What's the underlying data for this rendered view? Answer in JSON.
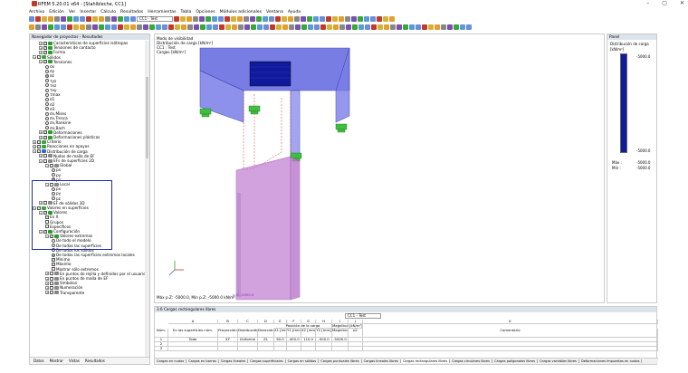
{
  "window": {
    "title": "RFEM 5.20.01 x64 - [Stahlbleche, CC1]",
    "controls": [
      "–",
      "▢",
      "✕"
    ]
  },
  "menu": [
    "Archivo",
    "Edición",
    "Ver",
    "Insertar",
    "Cálculo",
    "Resultados",
    "Herramientas",
    "Tabla",
    "Opciones",
    "Módulos adicionales",
    "Ventana",
    "Ayuda"
  ],
  "toolbar": {
    "case_combo": "CC1 - Test"
  },
  "navigator": {
    "title": "Navegador de proyectos - Resultados",
    "items": [
      {
        "label": "Características de superficies isótropas",
        "level": 1,
        "ex": "+",
        "cb": true,
        "color": "#2b9b2b"
      },
      {
        "label": "Tensiones de contacto",
        "level": 1,
        "ex": "+",
        "cb": true,
        "color": "#2b9b2b"
      },
      {
        "label": "Forma",
        "level": 1,
        "ex": "+",
        "cb": true,
        "color": "#2b9b2b"
      },
      {
        "label": "Sólidos",
        "level": 0,
        "ex": "−",
        "cb": true,
        "color": "#3aa63a"
      },
      {
        "label": "Tensiones",
        "level": 1,
        "ex": "−",
        "cb": true,
        "color": "#2b9b2b"
      },
      {
        "label": "σx",
        "level": 2,
        "radio": false
      },
      {
        "label": "σy",
        "level": 2,
        "radio": false
      },
      {
        "label": "σz",
        "level": 2,
        "radio": true
      },
      {
        "label": "τyz",
        "level": 2,
        "radio": false
      },
      {
        "label": "τxz",
        "level": 2,
        "radio": false
      },
      {
        "label": "τxy",
        "level": 2,
        "radio": false
      },
      {
        "label": "τmax",
        "level": 2,
        "radio": false
      },
      {
        "label": "σ1",
        "level": 2,
        "radio": false
      },
      {
        "label": "σ2",
        "level": 2,
        "radio": false
      },
      {
        "label": "σ3",
        "level": 2,
        "radio": false
      },
      {
        "label": "σv,Mises",
        "level": 2,
        "radio": false
      },
      {
        "label": "σv,Tresca",
        "level": 2,
        "radio": false
      },
      {
        "label": "σv,Rankine",
        "level": 2,
        "radio": false
      },
      {
        "label": "σv,Bach",
        "level": 2,
        "radio": false
      },
      {
        "label": "Deformaciones",
        "level": 1,
        "ex": "+",
        "cb": true,
        "color": "#2b9b2b"
      },
      {
        "label": "Deformaciones plásticas",
        "level": 1,
        "ex": "+",
        "cb": true,
        "color": "#2b9b2b"
      },
      {
        "label": "Criterio",
        "level": 0,
        "ex": "+",
        "cb": true,
        "color": "#3aa63a"
      },
      {
        "label": "Reacciones en apoyos",
        "level": 0,
        "ex": "+",
        "cb": true,
        "color": "#3aa63a"
      },
      {
        "label": "Distribución de carga",
        "level": 0,
        "ex": "−",
        "cb": true,
        "color": "#3366cc"
      },
      {
        "label": "Nudos de malla de EF",
        "level": 1,
        "ex": "+",
        "cb": false,
        "color": "#888"
      },
      {
        "label": "EFs de superficies 2D",
        "level": 1,
        "ex": "−",
        "cb": false,
        "color": "#888"
      },
      {
        "label": "Global",
        "level": 2,
        "ex": "−",
        "cb": false,
        "color": "#888"
      },
      {
        "label": "px",
        "level": 3,
        "radio": false
      },
      {
        "label": "py",
        "level": 3,
        "radio": false
      },
      {
        "label": "pz",
        "level": 3,
        "radio": true
      },
      {
        "label": "Local",
        "level": 2,
        "ex": "−",
        "cb": false,
        "color": "#888"
      },
      {
        "label": "px",
        "level": 3,
        "radio": false
      },
      {
        "label": "py",
        "level": 3,
        "radio": false
      },
      {
        "label": "pz",
        "level": 3,
        "radio": false
      },
      {
        "label": "EF de sólidos 3D",
        "level": 1,
        "ex": "+",
        "cb": false,
        "color": "#888"
      },
      {
        "label": "Valores en superficies",
        "level": 0,
        "ex": "−",
        "cb": true,
        "color": "#3aa63a"
      },
      {
        "label": "Valores",
        "level": 1,
        "ex": "−",
        "cb": true,
        "color": "#2b9b2b"
      },
      {
        "label": "En X",
        "level": 2,
        "cb": true
      },
      {
        "label": "Grupos",
        "level": 2,
        "cb": false
      },
      {
        "label": "Específicos",
        "level": 2,
        "cb": false
      },
      {
        "label": "Configuración",
        "level": 1,
        "ex": "−",
        "cb": true,
        "color": "#2b9b2b"
      },
      {
        "label": "Valores extremos",
        "level": 2,
        "ex": "−",
        "cb": true,
        "color": "#2b9b2b"
      },
      {
        "label": "De todo el modelo",
        "level": 3,
        "radio": false
      },
      {
        "label": "De todas las superficies",
        "level": 3,
        "radio": false
      },
      {
        "label": "De todos los sólidos",
        "level": 3,
        "radio": false
      },
      {
        "label": "De todas las superficies extremos locales",
        "level": 3,
        "radio": true
      },
      {
        "label": "Mínimo",
        "level": 3,
        "cb": true
      },
      {
        "label": "Máximo",
        "level": 3,
        "cb": true
      },
      {
        "label": "Mostrar sólo extremos",
        "level": 3,
        "cb": false
      },
      {
        "label": "En puntos de rejilla y definidos por el usuario",
        "level": 2,
        "ex": "+",
        "cb": false,
        "color": "#888"
      },
      {
        "label": "En puntos de malla de EF",
        "level": 2,
        "ex": "+",
        "cb": false,
        "color": "#888"
      },
      {
        "label": "Símbolos",
        "level": 2,
        "ex": "+",
        "cb": false,
        "color": "#888"
      },
      {
        "label": "Numeración",
        "level": 2,
        "ex": "+",
        "cb": false,
        "color": "#888"
      },
      {
        "label": "Transparente",
        "level": 2,
        "ex": "+",
        "cb": false,
        "color": "#888"
      }
    ],
    "tabs": [
      "Datos",
      "Mostrar",
      "Vistas",
      "Resultados"
    ]
  },
  "view": {
    "info": [
      "Modo de visibilidad",
      "Distribución de carga [kN/m²]",
      "CC1 : Test",
      "Cargas [kN/m²]"
    ],
    "footer": "Máx p.Z: -5000.0, Mín p.Z: -5000.0 kN/m²",
    "load_label": "p.Z: -5000.0"
  },
  "panel": {
    "title": "Panel",
    "heading": "Distribución de carga",
    "unit": "[kN/m²]",
    "top_value": "-5000.0",
    "bottom_value": "-5000.0",
    "max_label": "Máx :",
    "max_value": "-5000.0",
    "min_label": "Mín :",
    "min_value": "-5000.0"
  },
  "table": {
    "title": "3.6 Cargas rectangulares libres",
    "combo": "CC1 - Test",
    "col_letters": [
      "A",
      "B",
      "C",
      "D",
      "E",
      "F",
      "G",
      "H",
      "I",
      "J",
      "K"
    ],
    "headers": [
      "Núm.",
      "En las superficies núm.",
      "Proyección",
      "Distribución de carga",
      "Dirección de carga",
      "X1 [mm]",
      "Y1 [mm]",
      "X2 [mm]",
      "Y2 [mm]",
      "Magnitud p1",
      "p2",
      "Comentario"
    ],
    "group_header": "Posición de la carga",
    "magnitude_header": "Magnitud [kN/m²]",
    "rows": [
      [
        "1",
        "Todo",
        "XY",
        "Uniforme",
        "ZL",
        "90.0",
        "-400.0",
        "110.0",
        "-500.0",
        "-5000.0",
        "",
        ""
      ],
      [
        "2",
        "",
        "",
        "",
        "",
        "",
        "",
        "",
        "",
        "",
        "",
        ""
      ],
      [
        "3",
        "",
        "",
        "",
        "",
        "",
        "",
        "",
        "",
        "",
        "",
        ""
      ]
    ],
    "tabs": [
      "Cargas en nudos",
      "Cargas en barras",
      "Cargas lineales",
      "Cargas superficiales",
      "Cargas en sólidos",
      "Cargas puntuales libres",
      "Cargas lineales libres",
      "Cargas rectangulares libres",
      "Cargas circulares libres",
      "Cargas poligonales libres",
      "Cargas variables libres",
      "Deformaciones impuestas en nudos"
    ],
    "active_tab": 7
  },
  "colors": {
    "load": "#111a9a",
    "surface": "#6a6fe0",
    "solid": "#c88bd8",
    "support": "#3fbe3f"
  }
}
